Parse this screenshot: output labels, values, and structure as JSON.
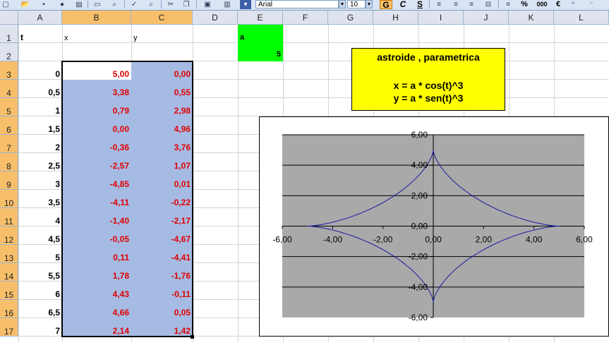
{
  "toolbar": {
    "font_name": "Arial",
    "font_size": "10",
    "bold_label": "G",
    "italic_label": "C",
    "underline_label": "S",
    "percent_label": "%",
    "thousands_label": "000",
    "euro_label": "€",
    "icons": [
      "new-icon",
      "open-icon",
      "save-icon",
      "permission-icon",
      "print-icon",
      "print-preview-icon",
      "spelling-icon",
      "research-icon",
      "cut-icon",
      "copy-icon",
      "paste-icon",
      "chart-wizard-icon",
      "align-left-icon",
      "align-center-icon",
      "align-right-icon",
      "merge-center-icon",
      "currency-icon"
    ]
  },
  "columns": [
    "A",
    "B",
    "C",
    "D",
    "E",
    "F",
    "G",
    "H",
    "I",
    "J",
    "K",
    "L"
  ],
  "rows": [
    "1",
    "2",
    "3",
    "4",
    "5",
    "6",
    "7",
    "8",
    "9",
    "10",
    "11",
    "12",
    "13",
    "14",
    "15",
    "16",
    "17"
  ],
  "headers": {
    "t": "t",
    "x": "x",
    "y": "y",
    "a": "a"
  },
  "a_value": "5",
  "data_rows": [
    {
      "t": "0",
      "x": "5,00",
      "y": "0,00"
    },
    {
      "t": "0,5",
      "x": "3,38",
      "y": "0,55"
    },
    {
      "t": "1",
      "x": "0,79",
      "y": "2,98"
    },
    {
      "t": "1,5",
      "x": "0,00",
      "y": "4,96"
    },
    {
      "t": "2",
      "x": "-0,36",
      "y": "3,76"
    },
    {
      "t": "2,5",
      "x": "-2,57",
      "y": "1,07"
    },
    {
      "t": "3",
      "x": "-4,85",
      "y": "0,01"
    },
    {
      "t": "3,5",
      "x": "-4,11",
      "y": "-0,22"
    },
    {
      "t": "4",
      "x": "-1,40",
      "y": "-2,17"
    },
    {
      "t": "4,5",
      "x": "-0,05",
      "y": "-4,67"
    },
    {
      "t": "5",
      "x": "0,11",
      "y": "-4,41"
    },
    {
      "t": "5,5",
      "x": "1,78",
      "y": "-1,76"
    },
    {
      "t": "6",
      "x": "4,43",
      "y": "-0,11"
    },
    {
      "t": "6,5",
      "x": "4,66",
      "y": "0,05"
    },
    {
      "t": "7",
      "x": "2,14",
      "y": "1,42"
    }
  ],
  "info_box": {
    "title": "astroide , parametrica",
    "eq_x": "x = a * cos(t)^3",
    "eq_y": "y = a * sen(t)^3"
  },
  "colors": {
    "selection": "#a6bbe3",
    "header_active": "#f8bf6b",
    "header": "#dfe3ee",
    "a_cell": "#00ff00",
    "info_box": "#ffff00",
    "plot_area": "#a9a9a9",
    "series_line": "#1a1aa0",
    "value_text": "#e00000"
  },
  "chart_data": {
    "type": "scatter",
    "xlim": [
      -6,
      6
    ],
    "ylim": [
      -6,
      6
    ],
    "x_ticks": [
      "-6,00",
      "-4,00",
      "-2,00",
      "0,00",
      "2,00",
      "4,00",
      "6,00"
    ],
    "y_ticks": [
      "6,00",
      "4,00",
      "2,00",
      "0,00",
      "-2,00",
      "-4,00",
      "-6,00"
    ],
    "grid": "horizontal",
    "legend": "none",
    "curve": "astroid",
    "a": 5,
    "points_sampled": [
      [
        5.0,
        0.0
      ],
      [
        3.38,
        0.55
      ],
      [
        0.79,
        2.98
      ],
      [
        0.0,
        4.96
      ],
      [
        -0.36,
        3.76
      ],
      [
        -2.57,
        1.07
      ],
      [
        -4.85,
        0.01
      ],
      [
        -4.11,
        -0.22
      ],
      [
        -1.4,
        -2.17
      ],
      [
        -0.05,
        -4.67
      ],
      [
        0.11,
        -4.41
      ],
      [
        1.78,
        -1.76
      ],
      [
        4.43,
        -0.11
      ],
      [
        4.66,
        0.05
      ],
      [
        2.14,
        1.42
      ]
    ]
  }
}
